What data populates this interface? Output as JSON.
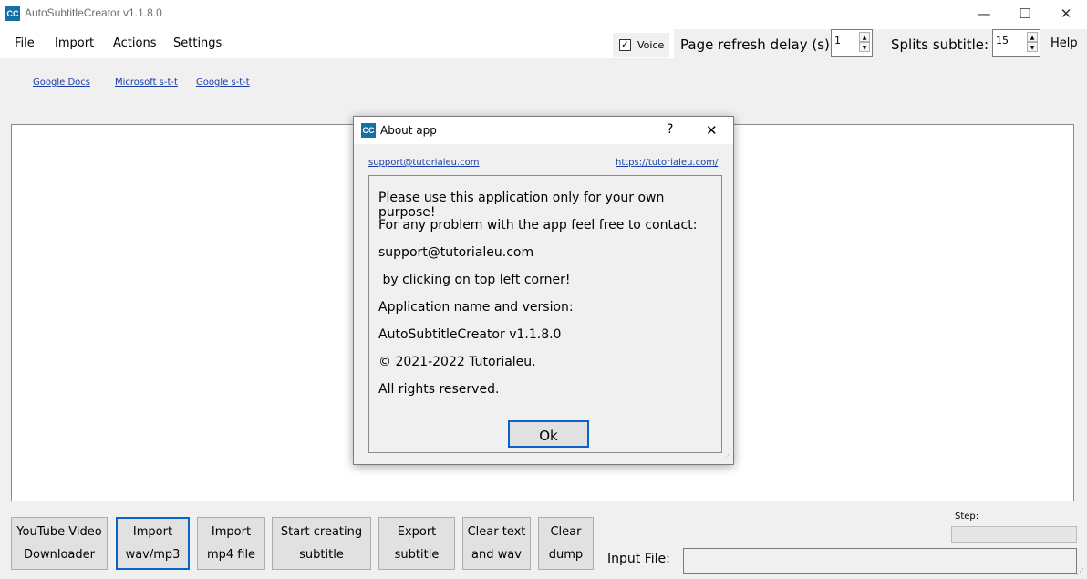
{
  "window": {
    "logo": "CC",
    "title": "AutoSubtitleCreator v1.1.8.0",
    "controls": {
      "minimize": "—",
      "maximize": "☐",
      "close": "✕"
    }
  },
  "menu": {
    "items": [
      "File",
      "Import",
      "Actions",
      "Settings"
    ],
    "voice_label": "Voice",
    "voice_checked": "✓",
    "page_refresh_label": "Page refresh delay (s):",
    "page_refresh_value": "1",
    "splits_label": "Splits subtitle:",
    "splits_value": "15",
    "help": "Help"
  },
  "links": [
    "Google Docs",
    "Microsoft s-t-t",
    "Google s-t-t"
  ],
  "bottom": {
    "buttons": [
      "YouTube Video\nDownloader",
      "Import\nwav/mp3",
      "Import\nmp4 file",
      "Start creating\nsubtitle",
      "Export\nsubtitle",
      "Clear text\nand wav",
      "Clear\ndump"
    ],
    "step_label": "Step:",
    "input_file_label": "Input File:",
    "input_file_value": ""
  },
  "dialog": {
    "logo": "CC",
    "title": "About app",
    "help_icon": "?",
    "close_icon": "✕",
    "email_link": "support@tutorialeu.com",
    "site_link": "https://tutorialeu.com/",
    "lines": [
      "Please use this application only for your own purpose!",
      "For any problem with the app feel free to contact:",
      "support@tutorialeu.com",
      " by clicking on top left corner!",
      "Application name and version:",
      "AutoSubtitleCreator v1.1.8.0",
      "© 2021-2022 Tutorialeu.",
      "All rights reserved."
    ],
    "ok_label": "Ok"
  },
  "colors": {
    "accent": "#0a64c8",
    "logo_bg": "#1570a8",
    "link": "#1a3ea8"
  }
}
